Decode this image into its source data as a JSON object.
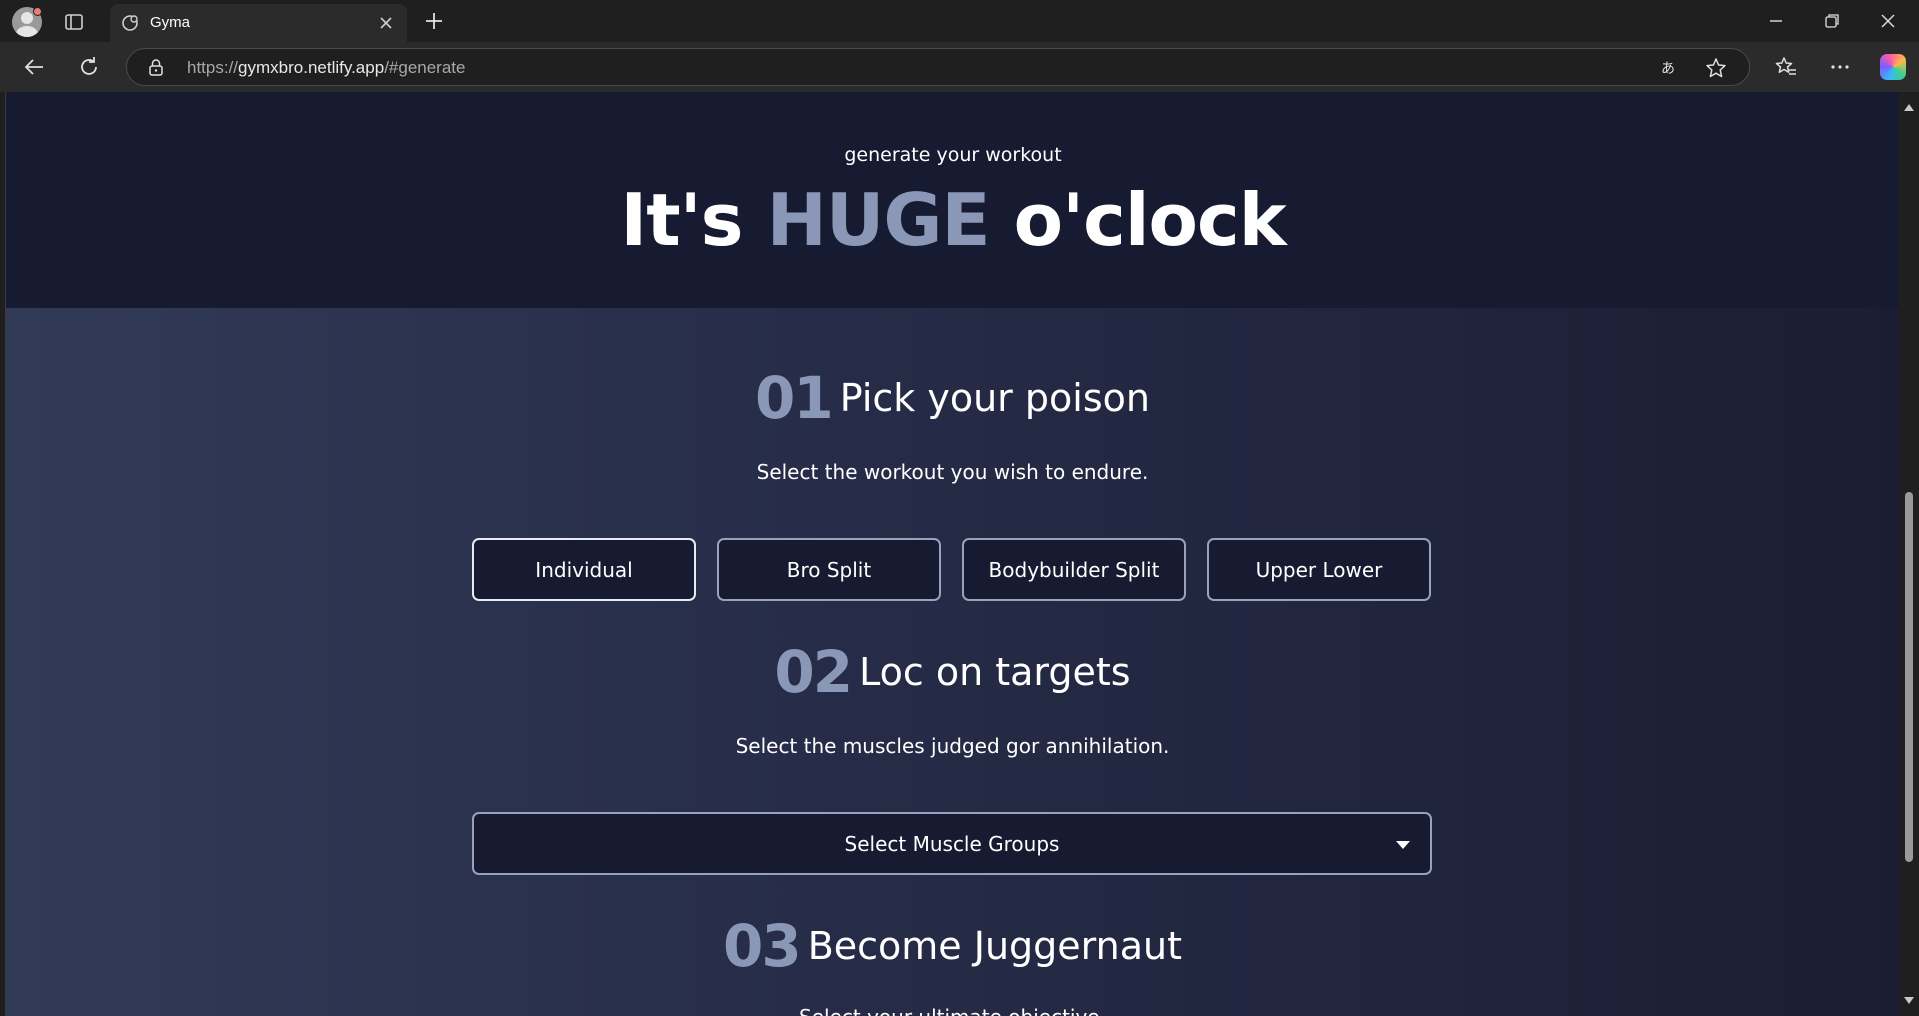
{
  "browser": {
    "tab_title": "Gyma",
    "url_prefix": "https://",
    "url_host": "gymxbro.netlify.app",
    "url_path": "/#generate",
    "icons": {
      "profile": "profile-avatar-icon",
      "sidebar": "sidebar-toggle-icon",
      "new_tab": "plus-icon",
      "back": "back-arrow-icon",
      "reload": "reload-icon",
      "lock": "lock-icon",
      "read_aloud": "translate-icon",
      "favorite": "star-icon",
      "favorites": "favorites-icon",
      "menu": "more-icon",
      "copilot": "copilot-icon"
    }
  },
  "hero": {
    "kicker": "generate your workout",
    "title_pre": "It's ",
    "title_accent": "HUGE",
    "title_post": " o'clock"
  },
  "section1": {
    "number": "01",
    "title": "Pick your poison",
    "description": "Select the workout you wish to endure.",
    "options": [
      "Individual",
      "Bro Split",
      "Bodybuilder Split",
      "Upper Lower"
    ],
    "selected": "Individual"
  },
  "section2": {
    "number": "02",
    "title": "Loc on targets",
    "description": "Select the muscles judged gor annihilation.",
    "select_label": "Select Muscle Groups"
  },
  "section3": {
    "number": "03",
    "title": "Become Juggernaut",
    "description": "Select your ultimate objective."
  },
  "colors": {
    "hero_bg": "#171b31",
    "accent": "#8b97b7",
    "gradient_left": "#313a57",
    "gradient_right": "#1b1d33"
  }
}
